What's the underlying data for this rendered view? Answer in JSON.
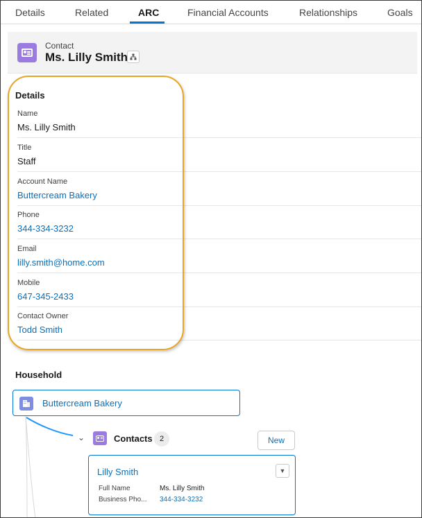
{
  "tabs": [
    "Details",
    "Related",
    "ARC",
    "Financial Accounts",
    "Relationships",
    "Goals"
  ],
  "active_tab": "ARC",
  "colors": {
    "accent": "#0176d3",
    "link": "#0b6fb8",
    "contact_icon": "#9b7be0",
    "account_icon": "#7f8de1",
    "highlight": "#e8a623"
  },
  "header": {
    "object_label": "Contact",
    "record_name": "Ms. Lilly Smith"
  },
  "details": {
    "title": "Details",
    "fields": [
      {
        "label": "Name",
        "value": "Ms. Lilly Smith",
        "link": false
      },
      {
        "label": "Title",
        "value": "Staff",
        "link": false
      },
      {
        "label": "Account Name",
        "value": "Buttercream Bakery",
        "link": true
      },
      {
        "label": "Phone",
        "value": "344-334-3232",
        "link": true
      },
      {
        "label": "Email",
        "value": "lilly.smith@home.com",
        "link": true
      },
      {
        "label": "Mobile",
        "value": "647-345-2433",
        "link": true
      },
      {
        "label": "Contact Owner",
        "value": "Todd Smith",
        "link": true
      }
    ]
  },
  "household": {
    "title": "Household",
    "account_name": "Buttercream Bakery",
    "contacts_label": "Contacts",
    "contacts_count": "2",
    "new_label": "New",
    "card": {
      "name": "Lilly Smith",
      "full_name_label": "Full Name",
      "full_name_value": "Ms. Lilly Smith",
      "phone_label": "Business Pho...",
      "phone_value": "344-334-3232"
    }
  }
}
